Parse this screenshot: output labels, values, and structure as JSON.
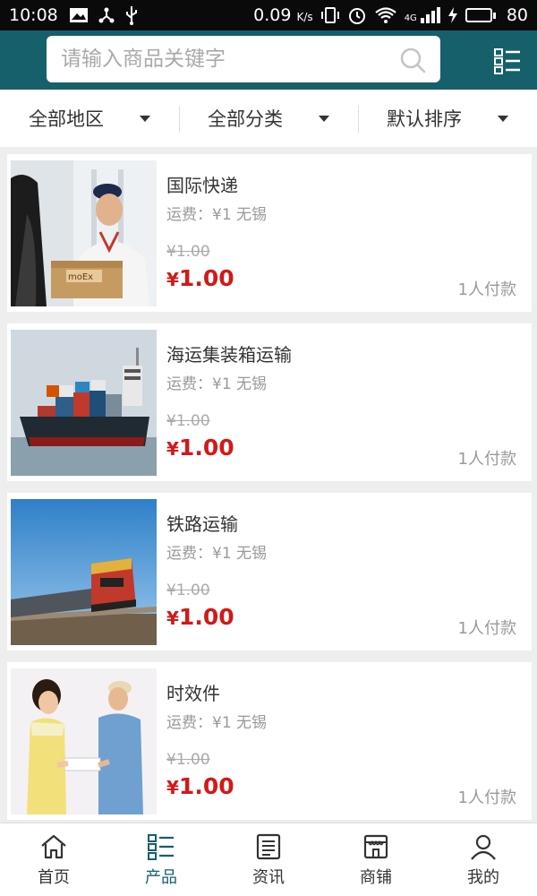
{
  "status_bar": {
    "time": "10:08",
    "net_speed": "0.09",
    "net_unit": "K/s",
    "signal_label": "4G",
    "battery": "80",
    "battery_level": 0.8
  },
  "header": {
    "search_placeholder": "请输入商品关键字"
  },
  "filters": [
    {
      "label": "全部地区"
    },
    {
      "label": "全部分类"
    },
    {
      "label": "默认排序"
    }
  ],
  "products": [
    {
      "title": "国际快递",
      "shipping": "运费：¥1 无锡",
      "old_price": "¥1.00",
      "currency": "¥",
      "price": "1.00",
      "sales": "1人付款",
      "image": "courier-photo"
    },
    {
      "title": "海运集装箱运输",
      "shipping": "运费：¥1 无锡",
      "old_price": "¥1.00",
      "currency": "¥",
      "price": "1.00",
      "sales": "1人付款",
      "image": "container-ship-photo"
    },
    {
      "title": "铁路运输",
      "shipping": "运费：¥1 无锡",
      "old_price": "¥1.00",
      "currency": "¥",
      "price": "1.00",
      "sales": "1人付款",
      "image": "freight-train-photo"
    },
    {
      "title": "时效件",
      "shipping": "运费：¥1 无锡",
      "old_price": "¥1.00",
      "currency": "¥",
      "price": "1.00",
      "sales": "1人付款",
      "image": "delivery-handover-photo"
    }
  ],
  "bottom_nav": [
    {
      "label": "首页",
      "icon": "home-icon",
      "active": false
    },
    {
      "label": "产品",
      "icon": "list-icon",
      "active": true
    },
    {
      "label": "资讯",
      "icon": "news-icon",
      "active": false
    },
    {
      "label": "商铺",
      "icon": "store-icon",
      "active": false
    },
    {
      "label": "我的",
      "icon": "user-icon",
      "active": false
    }
  ],
  "colors": {
    "header_bg": "#15606b",
    "price_red": "#d31919",
    "active_nav": "#15606b"
  }
}
